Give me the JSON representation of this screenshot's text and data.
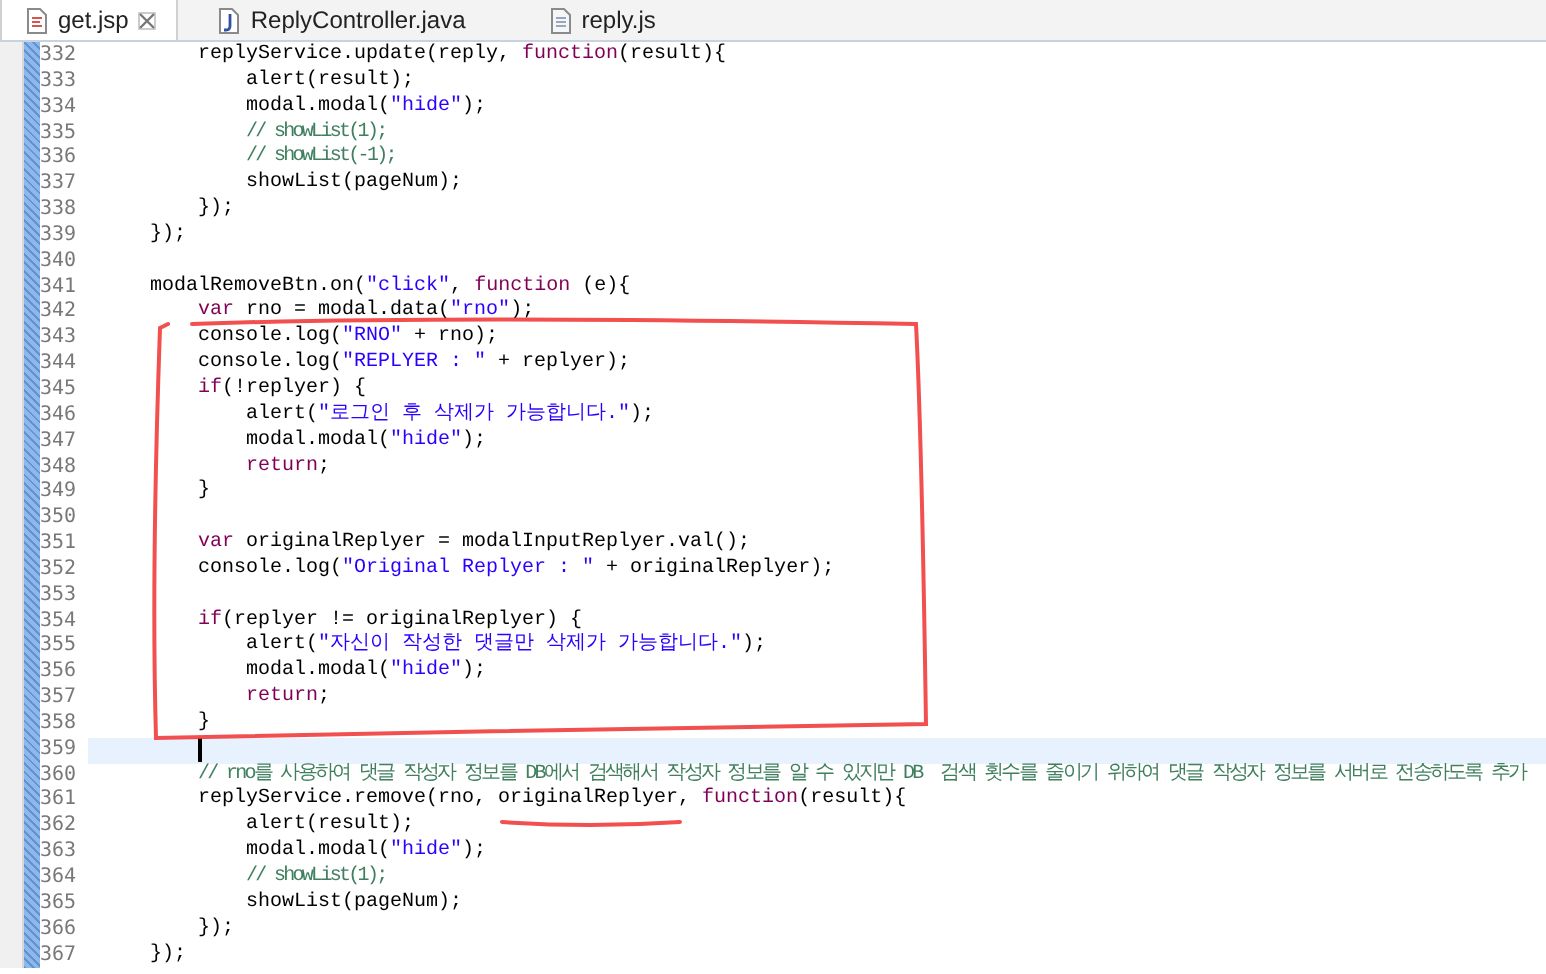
{
  "tabs": [
    {
      "label": "get.jsp",
      "kind": "jsp",
      "selected": true
    },
    {
      "label": "ReplyController.java",
      "kind": "java",
      "selected": false
    },
    {
      "label": "reply.js",
      "kind": "js",
      "selected": false
    }
  ],
  "editor": {
    "lines": [
      {
        "children": [
          {
            "number": "332",
            "current": false,
            "tokens": [
              {
                "kind": "plain",
                "text": "replyService.update(reply, "
              },
              {
                "kind": "kw",
                "text": "function"
              },
              {
                "kind": "plain",
                "text": "(result){"
              }
            ],
            "children": [
              {
                "number": "333",
                "current": false,
                "tokens": [
                  {
                    "kind": "plain",
                    "text": "alert(result);"
                  }
                ]
              },
              {
                "number": "334",
                "current": false,
                "tokens": [
                  {
                    "kind": "plain",
                    "text": "modal.modal("
                  },
                  {
                    "kind": "str",
                    "text": "\"hide\""
                  },
                  {
                    "kind": "plain",
                    "text": ");"
                  }
                ]
              },
              {
                "number": "335",
                "current": false,
                "tokens": [
                  {
                    "kind": "cm",
                    "text": "// showList(1);"
                  }
                ]
              },
              {
                "number": "336",
                "current": false,
                "tokens": [
                  {
                    "kind": "cm",
                    "text": "// showList(-1);"
                  }
                ]
              },
              {
                "number": "337",
                "current": false,
                "tokens": [
                  {
                    "kind": "plain",
                    "text": "showList(pageNum);"
                  }
                ]
              }
            ]
          },
          {
            "number": "338",
            "current": false,
            "tokens": [
              {
                "kind": "plain",
                "text": "});"
              }
            ]
          }
        ]
      },
      {
        "number": "339",
        "current": false,
        "tokens": [
          {
            "kind": "plain",
            "text": "});"
          }
        ]
      },
      {
        "number": "340",
        "current": false
      },
      {
        "number": "341",
        "current": false,
        "tokens": [
          {
            "kind": "plain",
            "text": "modalRemoveBtn.on("
          },
          {
            "kind": "str",
            "text": "\"click\""
          },
          {
            "kind": "plain",
            "text": ", "
          },
          {
            "kind": "kw",
            "text": "function"
          },
          {
            "kind": "plain",
            "text": " (e){"
          }
        ],
        "children": [
          {
            "number": "342",
            "current": false,
            "tokens": [
              {
                "kind": "kw",
                "text": "var"
              },
              {
                "kind": "plain",
                "text": " rno = modal.data("
              },
              {
                "kind": "str",
                "text": "\"rno\""
              },
              {
                "kind": "plain",
                "text": ");"
              }
            ]
          },
          {
            "number": "343",
            "current": false,
            "tokens": [
              {
                "kind": "plain",
                "text": "console.log("
              },
              {
                "kind": "str",
                "text": "\"RNO\""
              },
              {
                "kind": "plain",
                "text": " + rno);"
              }
            ]
          },
          {
            "number": "344",
            "current": false,
            "tokens": [
              {
                "kind": "plain",
                "text": "console.log("
              },
              {
                "kind": "str",
                "text": "\"REPLYER : \""
              },
              {
                "kind": "plain",
                "text": " + replyer);"
              }
            ]
          },
          {
            "number": "345",
            "current": false,
            "tokens": [
              {
                "kind": "kw",
                "text": "if"
              },
              {
                "kind": "plain",
                "text": "(!replyer) {"
              }
            ],
            "children": [
              {
                "number": "346",
                "current": false,
                "tokens": [
                  {
                    "kind": "plain",
                    "text": "alert("
                  },
                  {
                    "kind": "str",
                    "text": "\"로그인 후 삭제가 가능합니다.\""
                  },
                  {
                    "kind": "plain",
                    "text": ");"
                  }
                ]
              },
              {
                "number": "347",
                "current": false,
                "tokens": [
                  {
                    "kind": "plain",
                    "text": "modal.modal("
                  },
                  {
                    "kind": "str",
                    "text": "\"hide\""
                  },
                  {
                    "kind": "plain",
                    "text": ");"
                  }
                ]
              },
              {
                "number": "348",
                "current": false,
                "tokens": [
                  {
                    "kind": "kw",
                    "text": "return"
                  },
                  {
                    "kind": "plain",
                    "text": ";"
                  }
                ]
              }
            ]
          },
          {
            "number": "349",
            "current": false,
            "tokens": [
              {
                "kind": "plain",
                "text": "}"
              }
            ]
          },
          {
            "number": "350",
            "current": false
          },
          {
            "number": "351",
            "current": false,
            "tokens": [
              {
                "kind": "kw",
                "text": "var"
              },
              {
                "kind": "plain",
                "text": " originalReplyer = modalInputReplyer.val();"
              }
            ]
          },
          {
            "number": "352",
            "current": false,
            "tokens": [
              {
                "kind": "plain",
                "text": "console.log("
              },
              {
                "kind": "str",
                "text": "\"Original Replyer : \""
              },
              {
                "kind": "plain",
                "text": " + originalReplyer);"
              }
            ]
          },
          {
            "number": "353",
            "current": false
          },
          {
            "number": "354",
            "current": false,
            "tokens": [
              {
                "kind": "kw",
                "text": "if"
              },
              {
                "kind": "plain",
                "text": "(replyer != originalReplyer) {"
              }
            ],
            "children": [
              {
                "number": "355",
                "current": false,
                "tokens": [
                  {
                    "kind": "plain",
                    "text": "alert("
                  },
                  {
                    "kind": "str",
                    "text": "\"자신이 작성한 댓글만 삭제가 가능합니다.\""
                  },
                  {
                    "kind": "plain",
                    "text": ");"
                  }
                ]
              },
              {
                "number": "356",
                "current": false,
                "tokens": [
                  {
                    "kind": "plain",
                    "text": "modal.modal("
                  },
                  {
                    "kind": "str",
                    "text": "\"hide\""
                  },
                  {
                    "kind": "plain",
                    "text": ");"
                  }
                ]
              },
              {
                "number": "357",
                "current": false,
                "tokens": [
                  {
                    "kind": "kw",
                    "text": "return"
                  },
                  {
                    "kind": "plain",
                    "text": ";"
                  }
                ]
              }
            ]
          },
          {
            "number": "358",
            "current": false,
            "tokens": [
              {
                "kind": "plain",
                "text": "}"
              }
            ]
          },
          {
            "number": "359",
            "current": true
          },
          {
            "number": "360",
            "current": false,
            "tokens": [
              {
                "kind": "cm",
                "text": "// rno를 사용하여 댓글 작성자 정보를 DB에서 검색해서 작성자 정보를 알 수 있지만 DB  검색 횟수를 줄이기 위하여 댓글 작성자 정보를 서버로 전송하도록 추가"
              }
            ]
          },
          {
            "number": "361",
            "current": false,
            "tokens": [
              {
                "kind": "plain",
                "text": "replyService.remove(rno, originalReplyer, "
              },
              {
                "kind": "kw",
                "text": "function"
              },
              {
                "kind": "plain",
                "text": "(result){"
              }
            ],
            "children": [
              {
                "number": "362",
                "current": false,
                "tokens": [
                  {
                    "kind": "plain",
                    "text": "alert(result);"
                  }
                ]
              },
              {
                "number": "363",
                "current": false,
                "tokens": [
                  {
                    "kind": "plain",
                    "text": "modal.modal("
                  },
                  {
                    "kind": "str",
                    "text": "\"hide\""
                  },
                  {
                    "kind": "plain",
                    "text": ");"
                  }
                ]
              },
              {
                "number": "364",
                "current": false,
                "tokens": [
                  {
                    "kind": "cm",
                    "text": "// showList(1);"
                  }
                ]
              },
              {
                "number": "365",
                "current": false,
                "tokens": [
                  {
                    "kind": "plain",
                    "text": "showList(pageNum);"
                  }
                ]
              }
            ]
          },
          {
            "number": "366",
            "current": false,
            "tokens": [
              {
                "kind": "plain",
                "text": "});"
              }
            ]
          }
        ]
      },
      {
        "number": "367",
        "current": false,
        "tokens": [
          {
            "kind": "plain",
            "text": "});"
          }
        ]
      }
    ]
  }
}
